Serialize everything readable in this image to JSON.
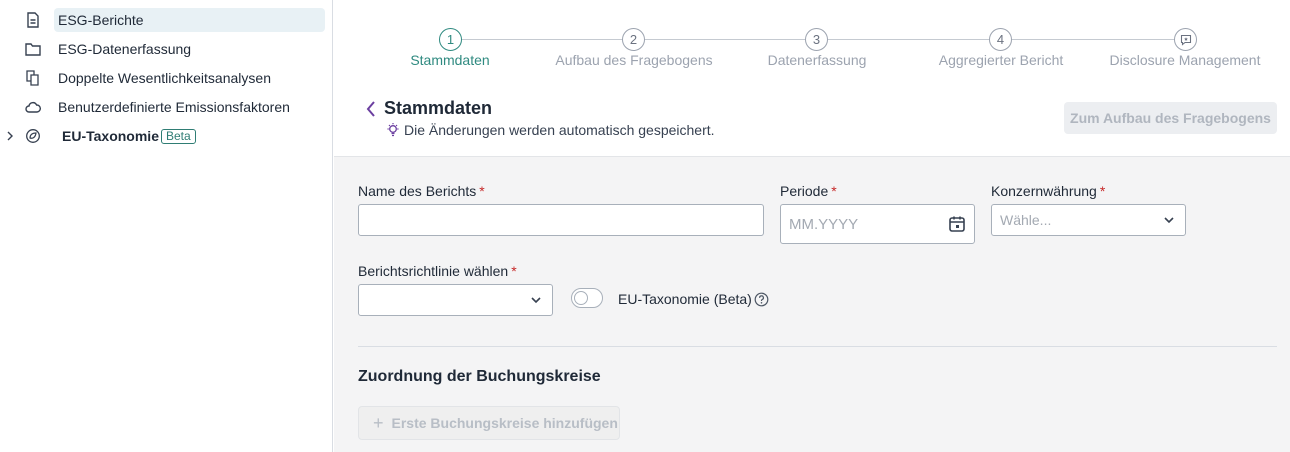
{
  "sidebar": {
    "items": [
      {
        "label": "ESG-Berichte",
        "icon": "document-icon",
        "active": true
      },
      {
        "label": "ESG-Datenerfassung",
        "icon": "folder-icon"
      },
      {
        "label": "Doppelte Wesentlichkeitsanalysen",
        "icon": "copy-document-icon"
      },
      {
        "label": "Benutzerdefinierte Emissionsfaktoren",
        "icon": "cloud-emission-icon"
      },
      {
        "label": "EU-Taxonomie",
        "icon": "leaf-globe-icon",
        "badge": "Beta",
        "expandable": true
      }
    ]
  },
  "stepper": {
    "steps": [
      {
        "number": "1",
        "label": "Stammdaten",
        "active": true
      },
      {
        "number": "2",
        "label": "Aufbau des Fragebogens"
      },
      {
        "number": "3",
        "label": "Datenerfassung"
      },
      {
        "number": "4",
        "label": "Aggregierter Bericht"
      },
      {
        "number": "",
        "label": "Disclosure Management",
        "icon": "comment-icon"
      }
    ]
  },
  "header": {
    "title": "Stammdaten",
    "autosave": "Die Änderungen werden automatisch gespeichert.",
    "next_button": "Zum Aufbau des Fragebogens"
  },
  "form": {
    "report_name": {
      "label": "Name des Berichts",
      "value": ""
    },
    "period": {
      "label": "Periode",
      "placeholder": "MM.YYYY"
    },
    "currency": {
      "label": "Konzernwährung",
      "placeholder": "Wähle..."
    },
    "guideline": {
      "label": "Berichtsrichtlinie wählen",
      "value": ""
    },
    "eu_taxonomy": {
      "label": "EU-Taxonomie (Beta)",
      "enabled": false
    },
    "required_mark": "*"
  },
  "section": {
    "title": "Zuordnung der Buchungskreise",
    "add_button": "Erste Buchungskreise hinzufügen"
  },
  "colors": {
    "accent": "#2f8a80",
    "highlight": "#e8f1f5",
    "required": "#c62828",
    "chevron": "#6b3fa0"
  }
}
